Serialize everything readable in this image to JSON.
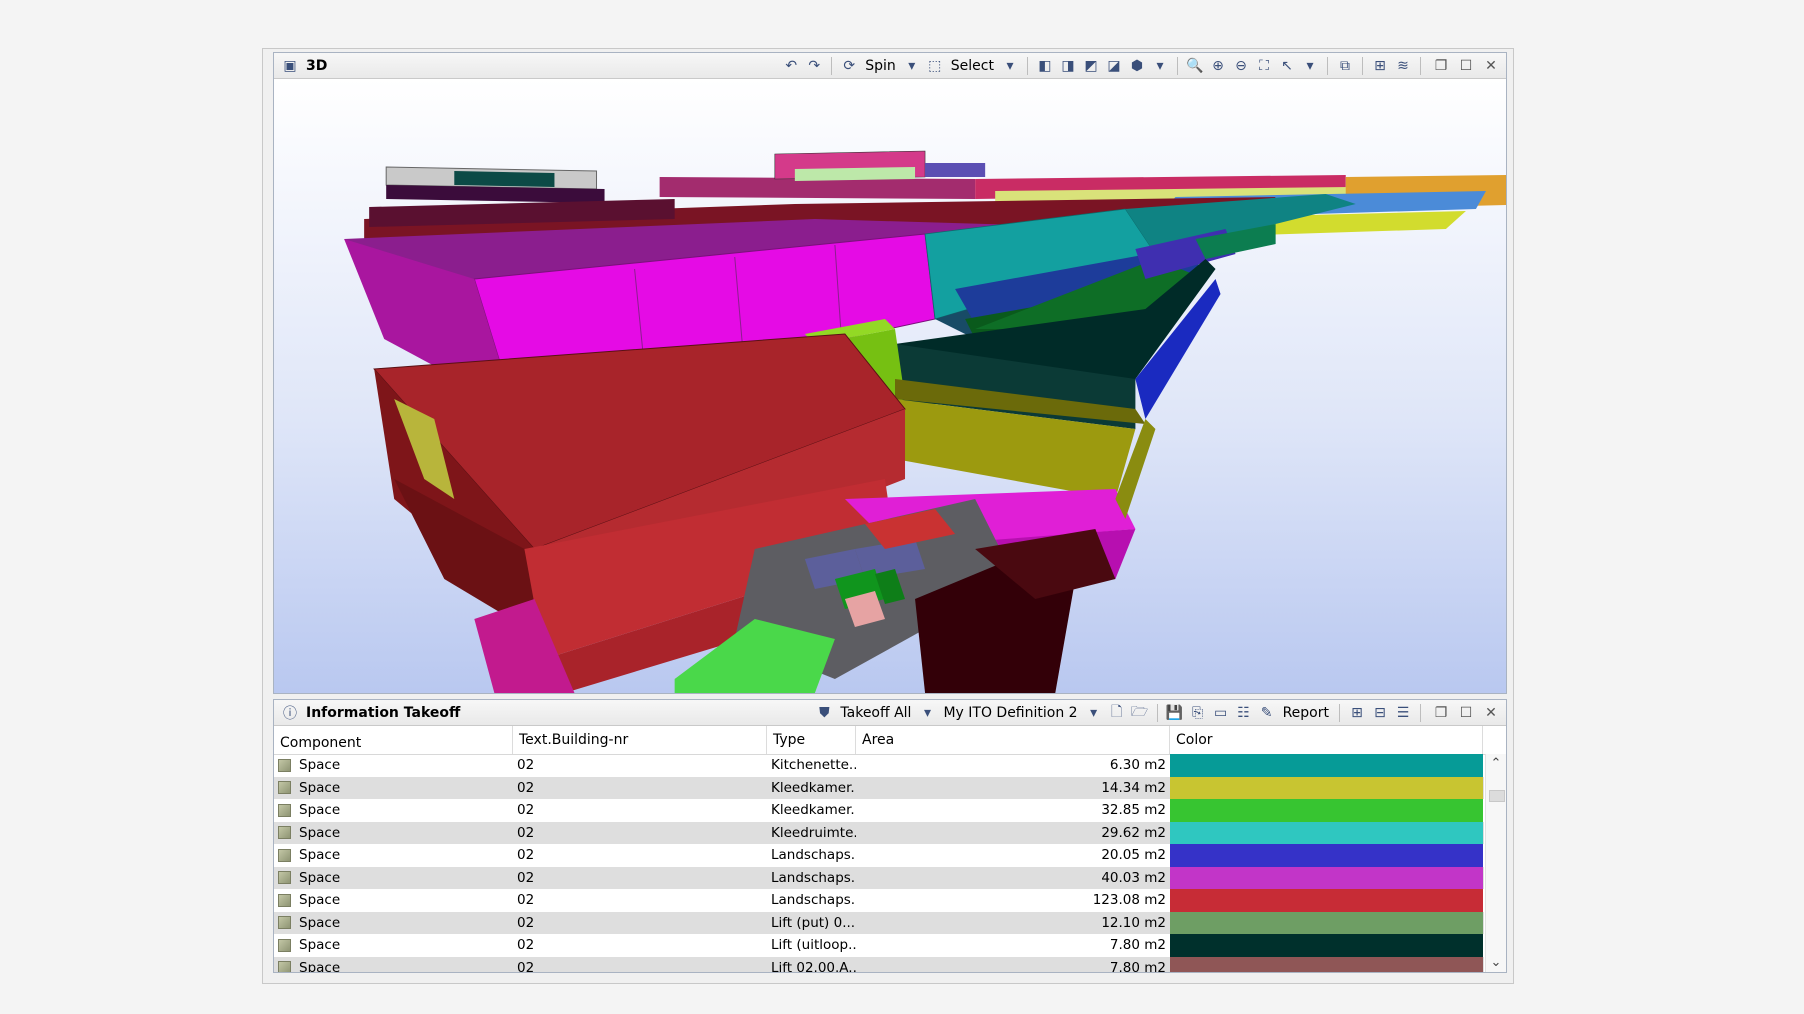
{
  "view3d": {
    "title": "3D",
    "spin_label": "Spin",
    "select_label": "Select"
  },
  "ito": {
    "title": "Information Takeoff",
    "takeoff_label": "Takeoff All",
    "definition_label": "My ITO Definition 2",
    "report_label": "Report",
    "columns": [
      "Component",
      "Text.Building-nr",
      "Type",
      "Area",
      "Color"
    ],
    "rows": [
      {
        "component": "Space",
        "building": "02",
        "type": "Kitchenette...",
        "area": "6.30 m2",
        "color": "#069b97"
      },
      {
        "component": "Space",
        "building": "02",
        "type": "Kleedkamer...",
        "area": "14.34 m2",
        "color": "#c8c531"
      },
      {
        "component": "Space",
        "building": "02",
        "type": "Kleedkamer...",
        "area": "32.85 m2",
        "color": "#37c531"
      },
      {
        "component": "Space",
        "building": "02",
        "type": "Kleedruimte...",
        "area": "29.62 m2",
        "color": "#2fc7c0"
      },
      {
        "component": "Space",
        "building": "02",
        "type": "Landschaps...",
        "area": "20.05 m2",
        "color": "#3532c8"
      },
      {
        "component": "Space",
        "building": "02",
        "type": "Landschaps...",
        "area": "40.03 m2",
        "color": "#c235c8"
      },
      {
        "component": "Space",
        "building": "02",
        "type": "Landschaps...",
        "area": "123.08 m2",
        "color": "#c72c36"
      },
      {
        "component": "Space",
        "building": "02",
        "type": "Lift (put) 0...",
        "area": "12.10 m2",
        "color": "#6e9e64"
      },
      {
        "component": "Space",
        "building": "02",
        "type": "Lift (uitloop...",
        "area": "7.80 m2",
        "color": "#00302c"
      },
      {
        "component": "Space",
        "building": "02",
        "type": "Lift 02.00.A...",
        "area": "7.80 m2",
        "color": "#8f5656"
      }
    ]
  }
}
